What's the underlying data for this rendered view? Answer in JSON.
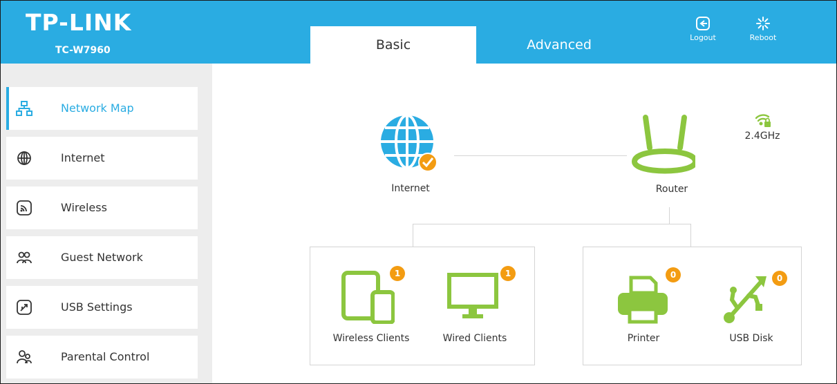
{
  "header": {
    "logo": "TP-LINK",
    "model": "TC-W7960",
    "tabs": [
      {
        "label": "Basic",
        "active": true
      },
      {
        "label": "Advanced",
        "active": false
      }
    ],
    "logout_label": "Logout",
    "reboot_label": "Reboot"
  },
  "sidebar": {
    "items": [
      {
        "label": "Network Map",
        "icon": "network-map-icon",
        "active": true
      },
      {
        "label": "Internet",
        "icon": "globe-icon"
      },
      {
        "label": "Wireless",
        "icon": "wireless-icon"
      },
      {
        "label": "Guest Network",
        "icon": "guest-network-icon"
      },
      {
        "label": "USB Settings",
        "icon": "usb-icon"
      },
      {
        "label": "Parental Control",
        "icon": "parental-control-icon"
      }
    ]
  },
  "map": {
    "internet_label": "Internet",
    "router_label": "Router",
    "band_label": "2.4GHz",
    "wireless_clients": {
      "label": "Wireless Clients",
      "count": "1"
    },
    "wired_clients": {
      "label": "Wired Clients",
      "count": "1"
    },
    "printer": {
      "label": "Printer",
      "count": "0"
    },
    "usb_disk": {
      "label": "USB Disk",
      "count": "0"
    }
  },
  "colors": {
    "brand_blue": "#2aace2",
    "device_green": "#8cc63f",
    "badge_orange": "#f39c12"
  }
}
